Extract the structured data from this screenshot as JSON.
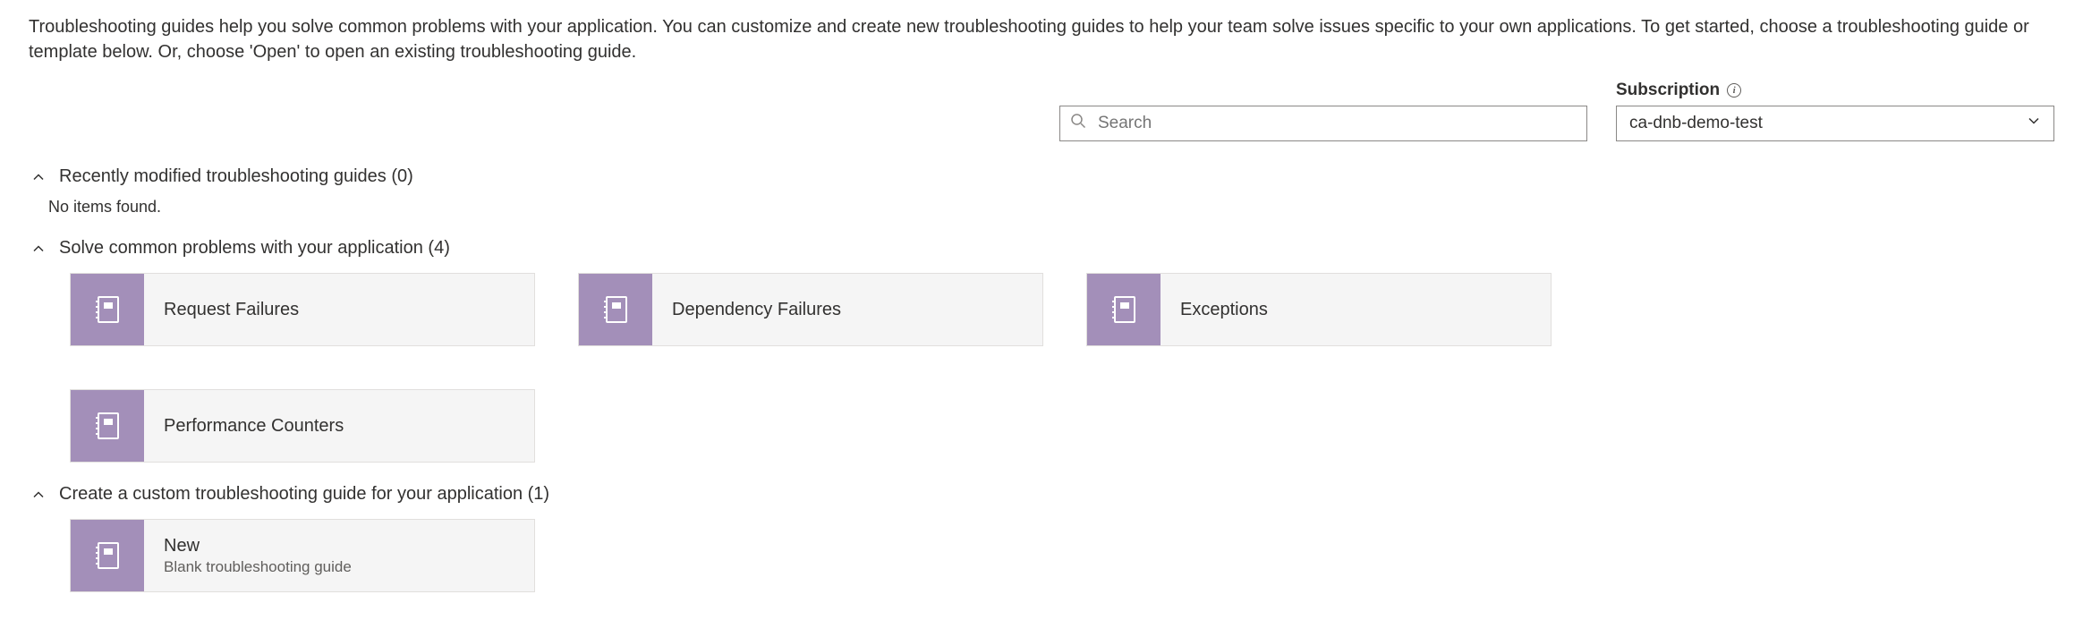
{
  "intro": "Troubleshooting guides help you solve common problems with your application. You can customize and create new troubleshooting guides to help your team solve issues specific to your own applications. To get started, choose a troubleshooting guide or template below. Or, choose 'Open' to open an existing troubleshooting guide.",
  "search": {
    "placeholder": "Search"
  },
  "subscription": {
    "label": "Subscription",
    "value": "ca-dnb-demo-test"
  },
  "sections": {
    "recent": {
      "title": "Recently modified troubleshooting guides (0)",
      "empty": "No items found."
    },
    "common": {
      "title": "Solve common problems with your application (4)",
      "tiles": [
        {
          "title": "Request Failures"
        },
        {
          "title": "Dependency Failures"
        },
        {
          "title": "Exceptions"
        },
        {
          "title": "Performance Counters"
        }
      ]
    },
    "custom": {
      "title": "Create a custom troubleshooting guide for your application (1)",
      "tiles": [
        {
          "title": "New",
          "subtitle": "Blank troubleshooting guide"
        }
      ]
    }
  }
}
